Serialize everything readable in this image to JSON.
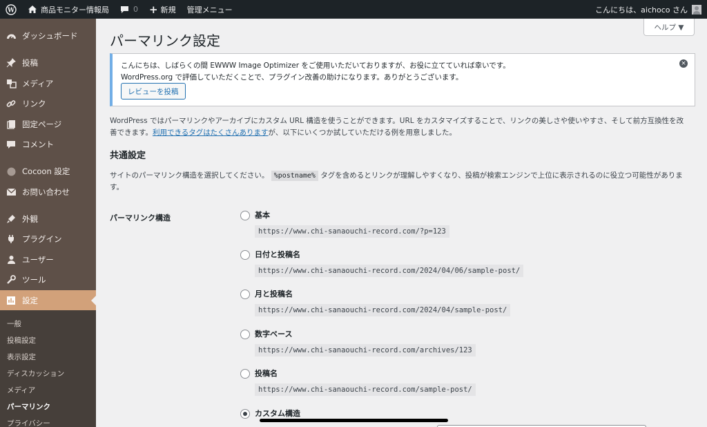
{
  "adminbar": {
    "site_name": "商品モニター情報局",
    "comments_count": "0",
    "new_label": "新規",
    "admin_menu_label": "管理メニュー",
    "greeting": "こんにちは、aichoco さん"
  },
  "sidebar": {
    "items": [
      {
        "label": "ダッシュボード",
        "icon": "dashboard-icon"
      },
      {
        "label": "投稿",
        "icon": "pin-icon"
      },
      {
        "label": "メディア",
        "icon": "media-icon"
      },
      {
        "label": "リンク",
        "icon": "link-icon"
      },
      {
        "label": "固定ページ",
        "icon": "page-icon"
      },
      {
        "label": "コメント",
        "icon": "comment-icon"
      },
      {
        "label": "Cocoon 設定",
        "icon": "cocoon-icon"
      },
      {
        "label": "お問い合わせ",
        "icon": "mail-icon"
      },
      {
        "label": "外観",
        "icon": "appearance-icon"
      },
      {
        "label": "プラグイン",
        "icon": "plugin-icon"
      },
      {
        "label": "ユーザー",
        "icon": "user-icon"
      },
      {
        "label": "ツール",
        "icon": "wrench-icon"
      },
      {
        "label": "設定",
        "icon": "settings-icon"
      }
    ],
    "submenu": [
      "一般",
      "投稿設定",
      "表示設定",
      "ディスカッション",
      "メディア",
      "パーマリンク",
      "プライバシー"
    ]
  },
  "page": {
    "title": "パーマリンク設定",
    "help_label": "ヘルプ ▼"
  },
  "notice": {
    "line1": "こんにちは、しばらくの間 EWWW Image Optimizer をご使用いただいておりますが、お役に立てていれば幸いです。",
    "line2": "WordPress.org で評価していただくことで、プラグイン改善の助けになります。ありがとうございます。",
    "button_label": "レビューを投稿"
  },
  "intro": {
    "line1": "WordPress ではパーマリンクやアーカイブにカスタム URL 構造を使うことができます。URL をカスタマイズすることで、リンクの美しさや使いやすさ、そして前方互換性を改",
    "line2_prefix": "善できます。",
    "line2_link": "利用できるタグはたくさんあります",
    "line2_suffix": "が、以下にいくつか試していただける例を用意しました。"
  },
  "common": {
    "title": "共通設定",
    "desc_prefix": "サイトのパーマリンク構造を選択してください。",
    "desc_code": "%postname%",
    "desc_suffix": "タグを含めるとリンクが理解しやすくなり、投稿が検索エンジンで上位に表示されるのに役立つ可能性がありま",
    "desc_line2": "す。"
  },
  "permalink": {
    "row_label": "パーマリンク構造",
    "options": [
      {
        "label": "基本",
        "example": "https://www.chi-sanaouchi-record.com/?p=123",
        "checked": false
      },
      {
        "label": "日付と投稿名",
        "example": "https://www.chi-sanaouchi-record.com/2024/04/06/sample-post/",
        "checked": false
      },
      {
        "label": "月と投稿名",
        "example": "https://www.chi-sanaouchi-record.com/2024/04/sample-post/",
        "checked": false
      },
      {
        "label": "数字ベース",
        "example": "https://www.chi-sanaouchi-record.com/archives/123",
        "checked": false
      },
      {
        "label": "投稿名",
        "example": "https://www.chi-sanaouchi-record.com/sample-post/",
        "checked": false
      },
      {
        "label": "カスタム構造",
        "example": "",
        "checked": true
      }
    ]
  },
  "colors": {
    "adminbar_bg": "#1d2327",
    "sidebar_bg": "#5e5048",
    "sidebar_current": "#d2a17a",
    "submenu_bg": "#463f3a",
    "notice_accent": "#72aee6",
    "link": "#2271b1"
  }
}
